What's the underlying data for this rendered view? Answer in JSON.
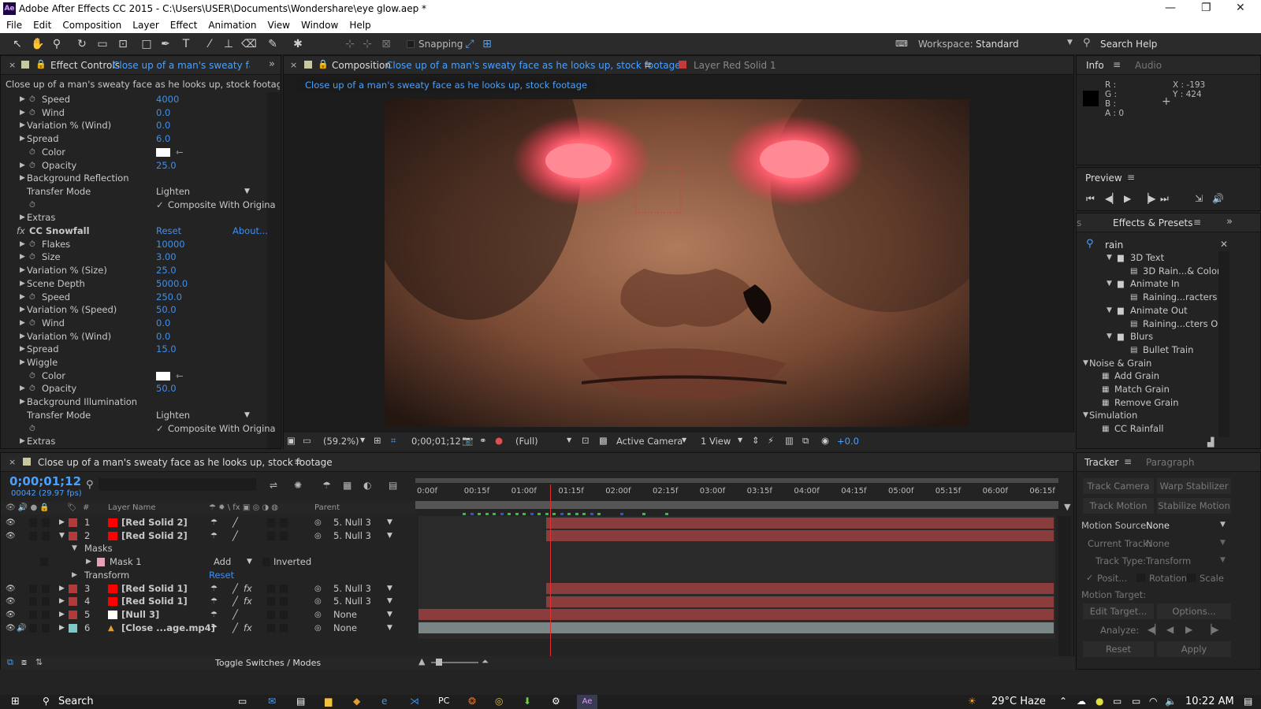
{
  "window": {
    "title": "Adobe After Effects CC 2015 - C:\\Users\\USER\\Documents\\Wondershare\\eye glow.aep *",
    "icon": "Ae"
  },
  "menu": [
    "File",
    "Edit",
    "Composition",
    "Layer",
    "Effect",
    "Animation",
    "View",
    "Window",
    "Help"
  ],
  "toolbar": {
    "snapping": "Snapping",
    "workspace_label": "Workspace:",
    "workspace_value": "Standard",
    "search_help": "Search Help"
  },
  "effect_controls": {
    "tab": "Effect Controls",
    "tab_target": "Close up of a man's sweaty face as",
    "layer_line": "Close up of a man's sweaty face as he looks up, stock footage • Clos",
    "rows": [
      {
        "label": "Speed",
        "value": "4000",
        "indent": 1,
        "tw": true,
        "sw": true
      },
      {
        "label": "Wind",
        "value": "0.0",
        "indent": 1,
        "tw": true,
        "sw": true
      },
      {
        "label": "Variation % (Wind)",
        "value": "0.0",
        "indent": 1,
        "tw": true
      },
      {
        "label": "Spread",
        "value": "6.0",
        "indent": 1,
        "tw": true
      },
      {
        "label": "Color",
        "value": "",
        "indent": 1,
        "sw": true,
        "color": true
      },
      {
        "label": "Opacity",
        "value": "25.0",
        "indent": 1,
        "tw": true,
        "sw": true
      },
      {
        "label": "Background Reflection",
        "value": "",
        "indent": 1,
        "tw": true
      },
      {
        "label": "Transfer Mode",
        "value": "",
        "indent": 2,
        "dropdown": "Lighten"
      },
      {
        "label": "",
        "value": "",
        "indent": 2,
        "sw": true,
        "check": "Composite With Origina"
      },
      {
        "label": "Extras",
        "value": "",
        "indent": 1,
        "tw": true
      },
      {
        "label": "CC Snowfall",
        "value": "Reset",
        "indent": 0,
        "fx": true,
        "about": "About..."
      },
      {
        "label": "Flakes",
        "value": "10000",
        "indent": 1,
        "tw": true,
        "sw": true
      },
      {
        "label": "Size",
        "value": "3.00",
        "indent": 1,
        "tw": true,
        "sw": true
      },
      {
        "label": "Variation % (Size)",
        "value": "25.0",
        "indent": 1,
        "tw": true
      },
      {
        "label": "Scene Depth",
        "value": "5000.0",
        "indent": 1,
        "tw": true
      },
      {
        "label": "Speed",
        "value": "250.0",
        "indent": 1,
        "tw": true,
        "sw": true
      },
      {
        "label": "Variation % (Speed)",
        "value": "50.0",
        "indent": 1,
        "tw": true
      },
      {
        "label": "Wind",
        "value": "0.0",
        "indent": 1,
        "tw": true,
        "sw": true
      },
      {
        "label": "Variation % (Wind)",
        "value": "0.0",
        "indent": 1,
        "tw": true
      },
      {
        "label": "Spread",
        "value": "15.0",
        "indent": 1,
        "tw": true
      },
      {
        "label": "Wiggle",
        "value": "",
        "indent": 1,
        "tw": true
      },
      {
        "label": "Color",
        "value": "",
        "indent": 1,
        "sw": true,
        "color": true
      },
      {
        "label": "Opacity",
        "value": "50.0",
        "indent": 1,
        "tw": true,
        "sw": true
      },
      {
        "label": "Background Illumination",
        "value": "",
        "indent": 1,
        "tw": true
      },
      {
        "label": "Transfer Mode",
        "value": "",
        "indent": 2,
        "dropdown": "Lighten"
      },
      {
        "label": "",
        "value": "",
        "indent": 2,
        "sw": true,
        "check": "Composite With Origina"
      },
      {
        "label": "Extras",
        "value": "",
        "indent": 1,
        "tw": true
      }
    ]
  },
  "composition": {
    "tab": "Composition",
    "tab_target": "Close up of a man's sweaty face as he looks up, stock footage",
    "layer_tab": "Layer Red Solid 1",
    "flow": "Close up of a man's sweaty face as he looks up, stock footage",
    "zoom": "(59.2%)",
    "timecode": "0;00;01;12",
    "resolution": "(Full)",
    "camera": "Active Camera",
    "views": "1 View",
    "exposure": "+0.0"
  },
  "info": {
    "tab": "Info",
    "tab2": "Audio",
    "r": "R :",
    "g": "G :",
    "b": "B :",
    "a": "A : 0",
    "x": "X : -193",
    "y": "Y : 424"
  },
  "preview": {
    "title": "Preview"
  },
  "effects_presets": {
    "tab": "Effects & Presets",
    "search": "rain",
    "items": [
      {
        "label": "3D Text",
        "level": 2,
        "type": "folder"
      },
      {
        "label": "3D Rain...& Colors",
        "level": 3,
        "type": "preset"
      },
      {
        "label": "Animate In",
        "level": 2,
        "type": "folder"
      },
      {
        "label": "Raining...racters In",
        "level": 3,
        "type": "preset"
      },
      {
        "label": "Animate Out",
        "level": 2,
        "type": "folder"
      },
      {
        "label": "Raining...cters Out",
        "level": 3,
        "type": "preset"
      },
      {
        "label": "Blurs",
        "level": 2,
        "type": "folder"
      },
      {
        "label": "Bullet Train",
        "level": 3,
        "type": "preset"
      },
      {
        "label": "Noise & Grain",
        "level": 0,
        "type": "cat"
      },
      {
        "label": "Add Grain",
        "level": 1,
        "type": "fx"
      },
      {
        "label": "Match Grain",
        "level": 1,
        "type": "fx"
      },
      {
        "label": "Remove Grain",
        "level": 1,
        "type": "fx"
      },
      {
        "label": "Simulation",
        "level": 0,
        "type": "cat"
      },
      {
        "label": "CC Rainfall",
        "level": 1,
        "type": "fx"
      }
    ]
  },
  "timeline": {
    "tab": "Close up of a man's sweaty face as he looks up, stock footage",
    "timecode": "0;00;01;12",
    "frames": "00042 (29.97 fps)",
    "col_layer": "Layer Name",
    "col_num": "#",
    "col_parent": "Parent",
    "ruler": [
      "0:00f",
      "00:15f",
      "01:00f",
      "01:15f",
      "02:00f",
      "02:15f",
      "03:00f",
      "03:15f",
      "04:00f",
      "04:15f",
      "05:00f",
      "05:15f",
      "06:00f",
      "06:15f"
    ],
    "layers": [
      {
        "num": "1",
        "name": "[Red Solid 2]",
        "color": "#ff0000",
        "label": "#b23a3a",
        "parent": "5. Null 3",
        "fx": false,
        "open": false,
        "bar_start": 0.2
      },
      {
        "num": "2",
        "name": "[Red Solid 2]",
        "color": "#ff0000",
        "label": "#b23a3a",
        "parent": "5. Null 3",
        "fx": false,
        "open": true,
        "bar_start": 0.2
      },
      {
        "num": "3",
        "name": "[Red Solid 1]",
        "color": "#ff0000",
        "label": "#b23a3a",
        "parent": "5. Null 3",
        "fx": true,
        "open": false,
        "bar_start": 0.2
      },
      {
        "num": "4",
        "name": "[Red Solid 1]",
        "color": "#ff0000",
        "label": "#b23a3a",
        "parent": "5. Null 3",
        "fx": true,
        "open": false,
        "bar_start": 0.2
      },
      {
        "num": "5",
        "name": "[Null 3]",
        "color": "#ffffff",
        "label": "#b23a3a",
        "parent": "None",
        "fx": false,
        "open": false,
        "bar_start": 0.0
      },
      {
        "num": "6",
        "name": "[Close ...age.mp4]",
        "color": "#e0a030",
        "label": "#7fc7c7",
        "parent": "None",
        "fx": true,
        "open": false,
        "bar_start": 0.0
      }
    ],
    "masks_label": "Masks",
    "mask_name": "Mask 1",
    "mask_mode": "Add",
    "inverted": "Inverted",
    "transform": "Transform",
    "reset": "Reset",
    "toggle": "Toggle Switches / Modes",
    "playhead_fraction": 0.21
  },
  "tracker": {
    "tab": "Tracker",
    "tab2": "Paragraph",
    "track_camera": "Track Camera",
    "warp_stabilizer": "Warp Stabilizer",
    "track_motion": "Track Motion",
    "stabilize_motion": "Stabilize Motion",
    "motion_source_label": "Motion Source:",
    "motion_source": "None",
    "current_track_label": "Current Track:",
    "current_track": "None",
    "track_type_label": "Track Type:",
    "track_type": "Transform",
    "position": "Posit...",
    "rotation": "Rotation",
    "scale": "Scale",
    "motion_target": "Motion Target:",
    "edit_target": "Edit Target...",
    "options": "Options...",
    "analyze": "Analyze:",
    "reset": "Reset",
    "apply": "Apply"
  },
  "taskbar": {
    "search": "Search",
    "weather": "29°C  Haze",
    "time": "10:22 AM"
  }
}
